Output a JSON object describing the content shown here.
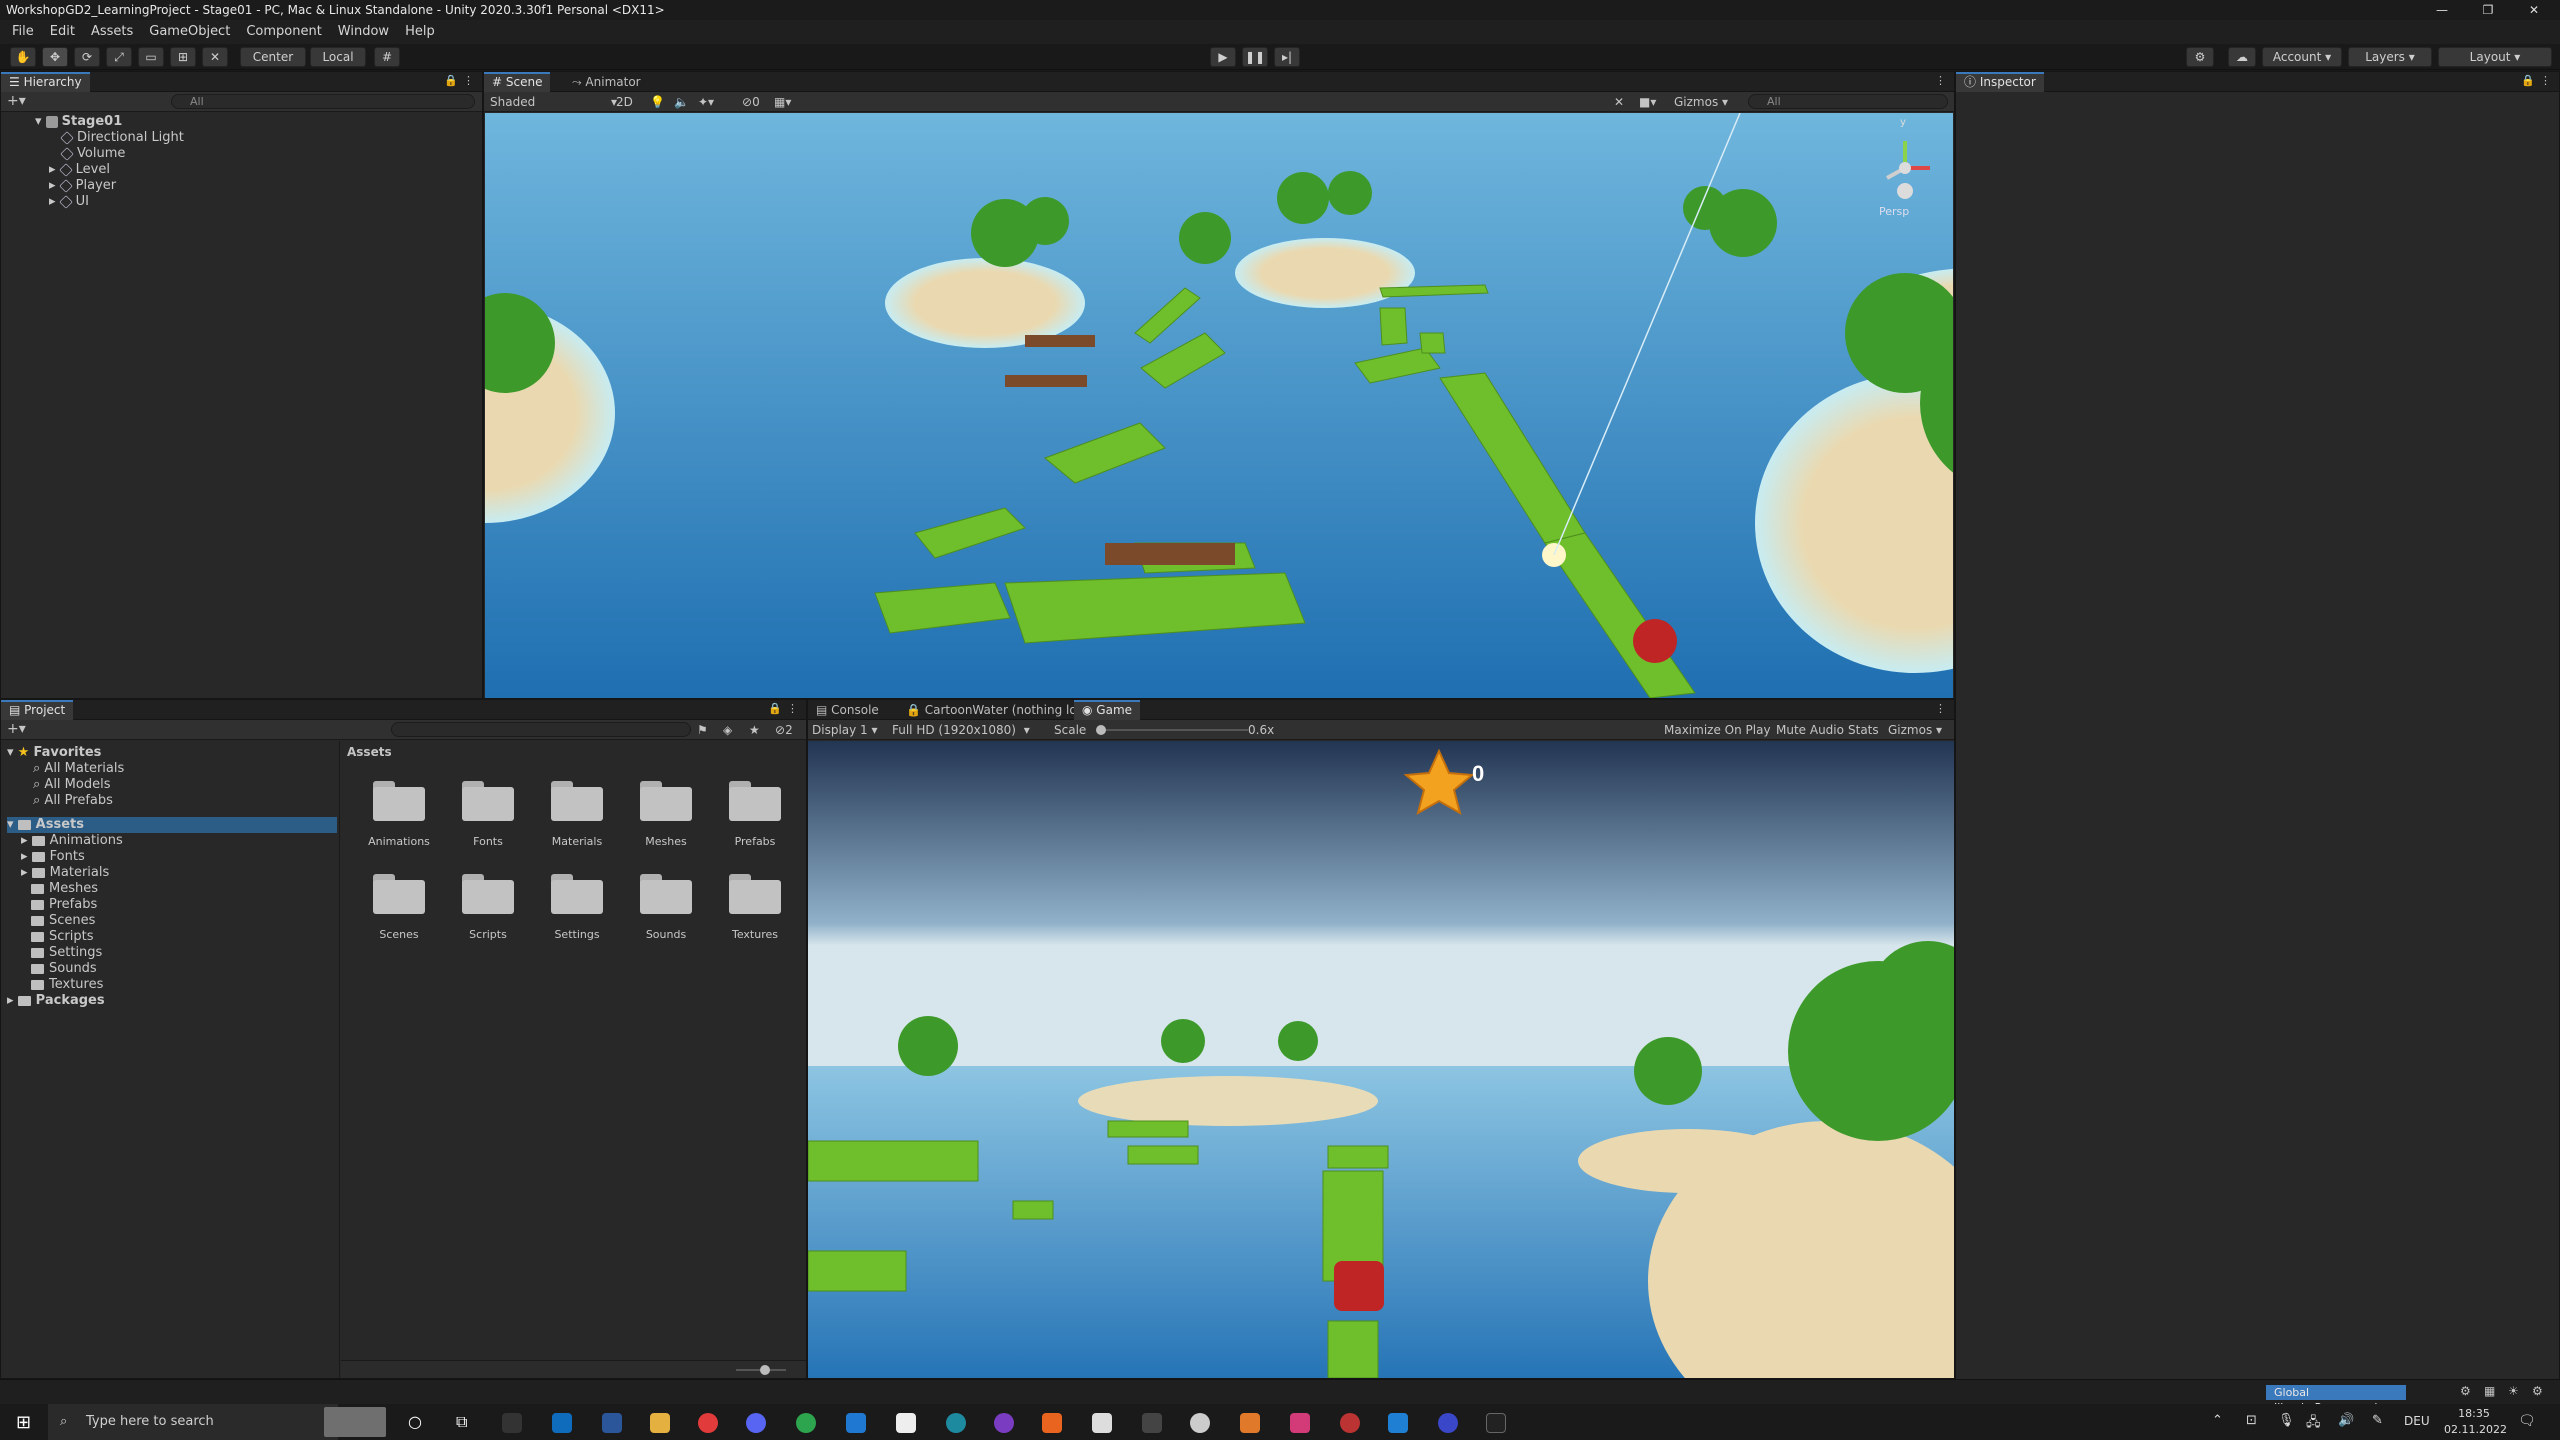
{
  "window": {
    "title": "WorkshopGD2_LearningProject - Stage01 - PC, Mac & Linux Standalone - Unity 2020.3.30f1 Personal <DX11>",
    "minimize": "—",
    "maximize": "❐",
    "close": "✕"
  },
  "menu": [
    "File",
    "Edit",
    "Assets",
    "GameObject",
    "Component",
    "Window",
    "Help"
  ],
  "toolbar": {
    "pivot_label": "Center",
    "space_label": "Local",
    "account_label": "Account",
    "layers_label": "Layers",
    "layout_label": "Layout"
  },
  "hierarchy": {
    "tab": "Hierarchy",
    "search_placeholder": "All",
    "scene": "Stage01",
    "items": [
      "Directional Light",
      "Volume",
      "Level",
      "Player",
      "UI"
    ]
  },
  "scene_view": {
    "tabs": [
      "Scene",
      "Animator"
    ],
    "shading": "Shaded",
    "mode_2d": "2D",
    "hidden_count": "0",
    "gizmos": "Gizmos",
    "search_placeholder": "All",
    "persp": "Persp",
    "axis_y": "y"
  },
  "inspector": {
    "tab": "Inspector"
  },
  "project": {
    "tab": "Project",
    "favorites_label": "Favorites",
    "favorites": [
      "All Materials",
      "All Models",
      "All Prefabs"
    ],
    "assets_label": "Assets",
    "asset_folders": [
      "Animations",
      "Fonts",
      "Materials",
      "Meshes",
      "Prefabs",
      "Scenes",
      "Scripts",
      "Settings",
      "Sounds",
      "Textures"
    ],
    "packages_label": "Packages",
    "breadcrumb": "Assets",
    "hidden_count": "2"
  },
  "game_view": {
    "tabs": [
      "Console",
      "CartoonWater (nothing lo...",
      "Game"
    ],
    "display": "Display 1",
    "resolution": "Full HD (1920x1080)",
    "scale_label": "Scale",
    "scale_value": "0.6x",
    "maximize": "Maximize On Play",
    "mute": "Mute Audio",
    "stats": "Stats",
    "gizmos": "Gizmos",
    "score": "0"
  },
  "status": {
    "progress_text": "Global Illumi...Preprocessing"
  },
  "taskbar": {
    "search_placeholder": "Type here to search",
    "lang": "DEU",
    "time": "18:35",
    "date": "02.11.2022"
  },
  "colors": {
    "accent": "#3a79bb",
    "water": "#2f86c6",
    "grass": "#6fbf2c",
    "sand": "#e9d9b3",
    "star": "#f3a21f"
  }
}
